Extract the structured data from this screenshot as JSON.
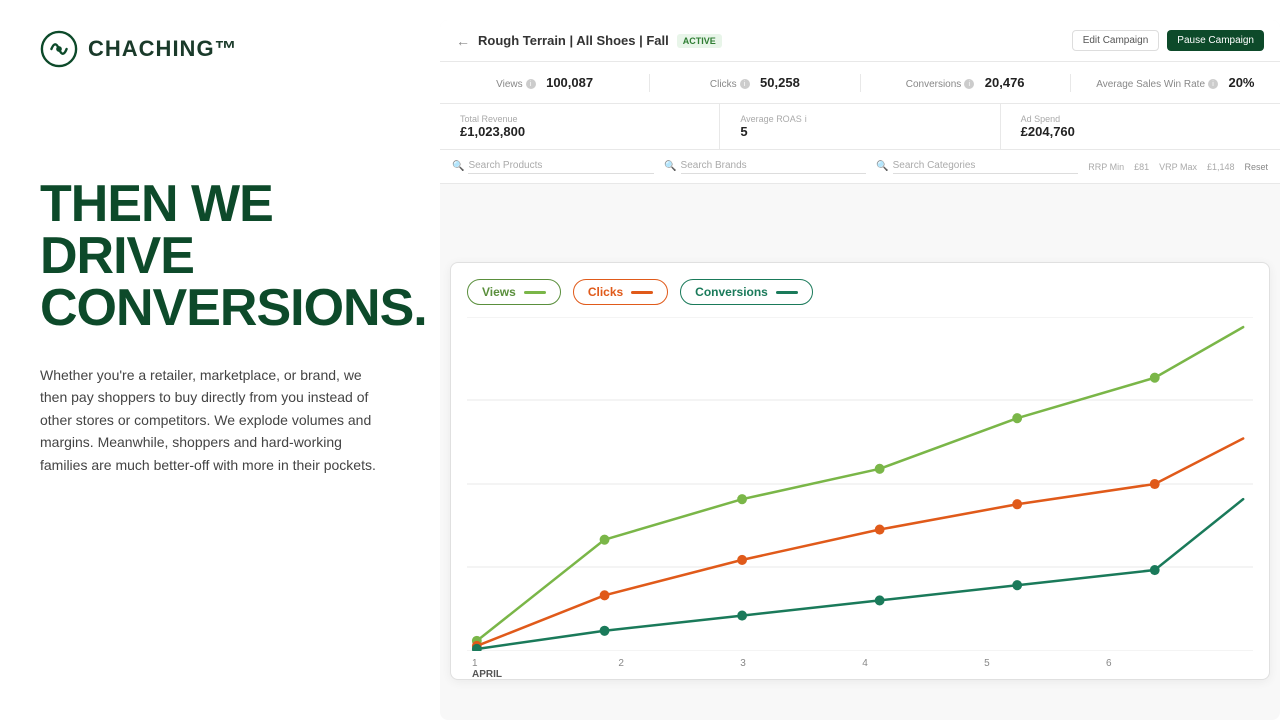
{
  "logo": {
    "text": "CHACHING™"
  },
  "headline": {
    "line1": "THEN WE DRIVE",
    "line2": "CONVERSIONS."
  },
  "subtext": "Whether you're a retailer, marketplace, or brand, we then pay shoppers to buy directly from you instead of other stores or competitors. We explode volumes and margins. Meanwhile, shoppers and hard-working families are much better-off with more in their pockets.",
  "dashboard": {
    "title": "Rough Terrain | All Shoes | Fall",
    "status": "ACTIVE",
    "buttons": {
      "edit": "Edit Campaign",
      "pause": "Pause Campaign"
    },
    "stats": {
      "views_label": "Views",
      "views_value": "100,087",
      "clicks_label": "Clicks",
      "clicks_value": "50,258",
      "conversions_label": "Conversions",
      "conversions_value": "20,476",
      "win_rate_label": "Average Sales Win Rate",
      "win_rate_value": "20%"
    },
    "stats2": {
      "revenue_label": "Total Revenue",
      "revenue_value": "£1,023,800",
      "roas_label": "Average ROAS",
      "roas_value": "5",
      "adspend_label": "Ad Spend",
      "adspend_value": "£204,760"
    },
    "search": {
      "placeholder1": "Search Products",
      "placeholder2": "Search Brands",
      "placeholder3": "Search Categories",
      "rrp_min_label": "RRP Min",
      "rrp_min_val": "£81",
      "rrp_max_label": "VRP Max",
      "rrp_max_val": "£1,148",
      "reset": "Reset"
    },
    "chart": {
      "legend": {
        "views": "Views",
        "clicks": "Clicks",
        "conversions": "Conversions"
      },
      "x_labels": [
        "1",
        "2",
        "3",
        "4",
        "5",
        "6"
      ],
      "x_month": "APRIL"
    }
  }
}
